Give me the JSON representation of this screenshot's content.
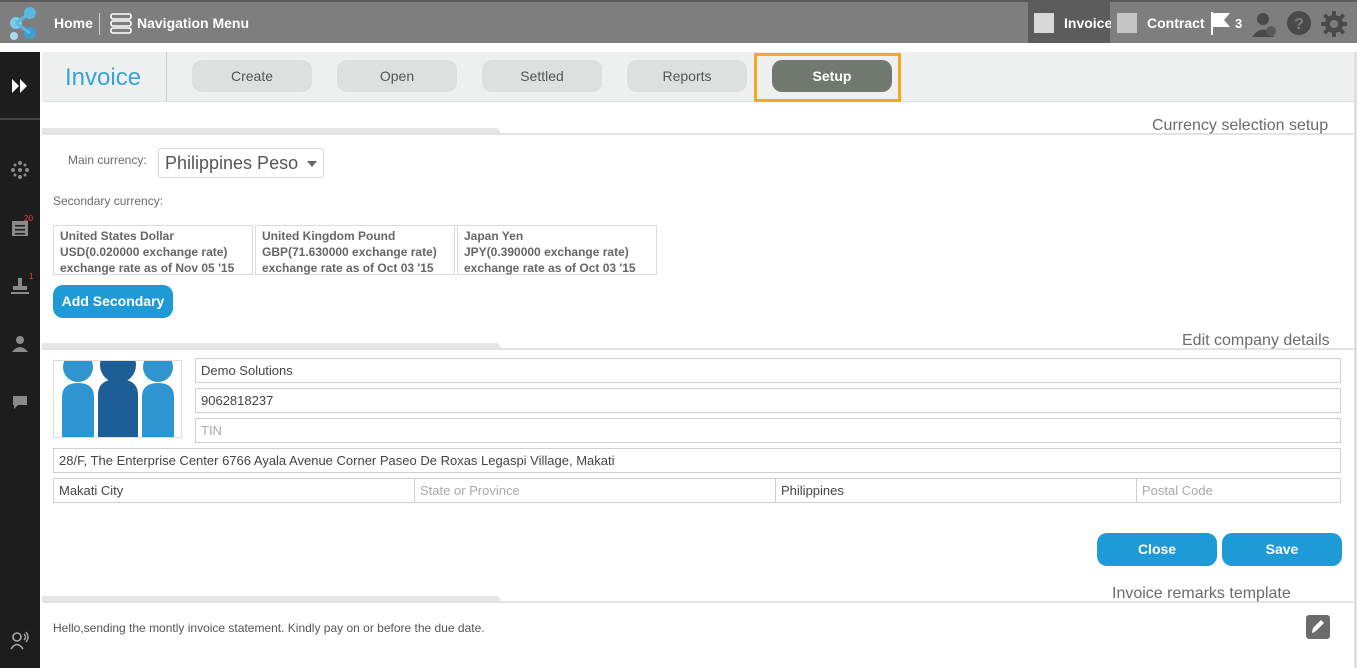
{
  "topbar": {
    "home": "Home",
    "nav_menu": "Navigation Menu",
    "tabs": [
      {
        "label": "Invoice",
        "icon": "document-icon"
      },
      {
        "label": "Contract",
        "icon": "grid-icon"
      }
    ],
    "flag_count": "3",
    "icons": [
      "user-add-icon",
      "help-icon",
      "gear-icon"
    ]
  },
  "sidebar": {
    "badges": {
      "list": "20",
      "stamp": "1"
    }
  },
  "header": {
    "title": "Invoice",
    "nav": [
      "Create",
      "Open",
      "Settled",
      "Reports",
      "Setup"
    ],
    "active": "Setup"
  },
  "currency": {
    "section_title": "Currency selection setup",
    "main_label": "Main currency:",
    "main_value": "Philippines Peso",
    "secondary_label": "Secondary currency:",
    "secondary": [
      {
        "name": "United States Dollar",
        "rate": "USD(0.020000 exchange rate)",
        "asof": "exchange rate as of Nov 05 '15"
      },
      {
        "name": "United Kingdom Pound",
        "rate": "GBP(71.630000 exchange rate)",
        "asof": "exchange rate as of Oct 03 '15"
      },
      {
        "name": "Japan Yen",
        "rate": "JPY(0.390000 exchange rate)",
        "asof": "exchange rate as of Oct 03 '15"
      }
    ],
    "add_button": "Add Secondary"
  },
  "company": {
    "section_title": "Edit company details",
    "name": "Demo Solutions",
    "phone": "9062818237",
    "tin_placeholder": "TIN",
    "address": "28/F, The Enterprise Center 6766 Ayala Avenue Corner Paseo De Roxas Legaspi Village, Makati",
    "city": "Makati City",
    "state_placeholder": "State or Province",
    "country": "Philippines",
    "postal_placeholder": "Postal Code",
    "close_button": "Close",
    "save_button": "Save"
  },
  "remarks": {
    "section_title": "Invoice remarks template",
    "text": "Hello,sending the montly invoice statement. Kindly pay on or before the due date."
  },
  "colors": {
    "accent": "#1e9bd7",
    "title": "#3aa2d6",
    "active_tab": "#707870",
    "highlight": "#f5a623"
  }
}
